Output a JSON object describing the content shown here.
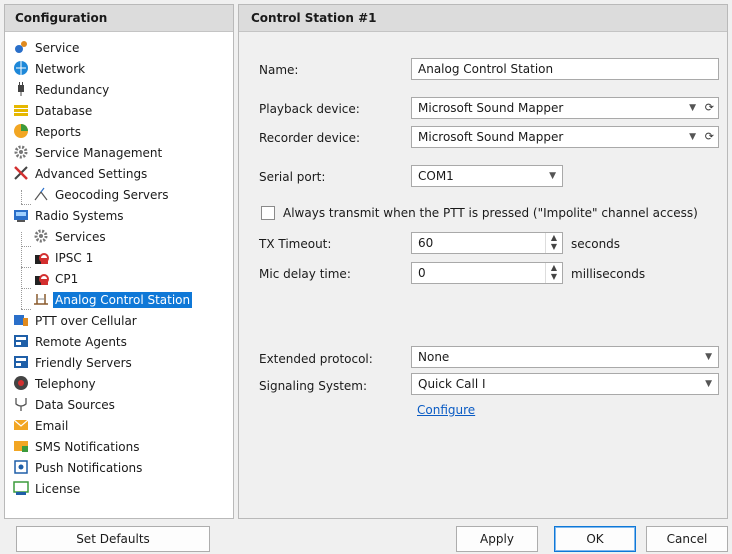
{
  "left": {
    "header": "Configuration",
    "tree": [
      {
        "label": "Service",
        "icon": "gears-icon"
      },
      {
        "label": "Network",
        "icon": "globe-icon"
      },
      {
        "label": "Redundancy",
        "icon": "plug-icon"
      },
      {
        "label": "Database",
        "icon": "database-icon"
      },
      {
        "label": "Reports",
        "icon": "reports-icon"
      },
      {
        "label": "Service Management",
        "icon": "gear-icon"
      },
      {
        "label": "Advanced Settings",
        "icon": "tools-icon"
      },
      {
        "label": "Geocoding Servers",
        "icon": "geocoding-icon"
      },
      {
        "label": "Radio Systems",
        "icon": "radio-systems-icon"
      },
      {
        "label": "Services",
        "icon": "gear-icon"
      },
      {
        "label": "IPSC 1",
        "icon": "radio-lock-icon"
      },
      {
        "label": "CP1",
        "icon": "radio-lock-icon"
      },
      {
        "label": "Analog Control Station",
        "icon": "antenna-icon"
      },
      {
        "label": "PTT over Cellular",
        "icon": "ptt-icon"
      },
      {
        "label": "Remote Agents",
        "icon": "remote-agents-icon"
      },
      {
        "label": "Friendly Servers",
        "icon": "friendly-servers-icon"
      },
      {
        "label": "Telephony",
        "icon": "telephone-icon"
      },
      {
        "label": "Data Sources",
        "icon": "data-sources-icon"
      },
      {
        "label": "Email",
        "icon": "email-icon"
      },
      {
        "label": "SMS Notifications",
        "icon": "sms-icon"
      },
      {
        "label": "Push Notifications",
        "icon": "push-icon"
      },
      {
        "label": "License",
        "icon": "license-icon"
      }
    ]
  },
  "right": {
    "header": "Control Station #1",
    "name_label": "Name:",
    "name_value": "Analog Control Station",
    "playback_label": "Playback device:",
    "playback_value": "Microsoft Sound Mapper",
    "recorder_label": "Recorder device:",
    "recorder_value": "Microsoft Sound Mapper",
    "serial_label": "Serial port:",
    "serial_value": "COM1",
    "always_transmit_label": "Always transmit when the PTT is pressed (\"Impolite\" channel access)",
    "always_transmit_checked": false,
    "tx_label": "TX Timeout:",
    "tx_value": "60",
    "tx_unit": "seconds",
    "mic_label": "Mic delay time:",
    "mic_value": "0",
    "mic_unit": "milliseconds",
    "ext_label": "Extended protocol:",
    "ext_value": "None",
    "signal_label": "Signaling System:",
    "signal_value": "Quick Call I",
    "configure_link": "Configure"
  },
  "buttons": {
    "set_defaults": "Set Defaults",
    "apply": "Apply",
    "ok": "OK",
    "cancel": "Cancel"
  },
  "colors": {
    "selection": "#0f78d7",
    "link": "#0b5cc4"
  }
}
